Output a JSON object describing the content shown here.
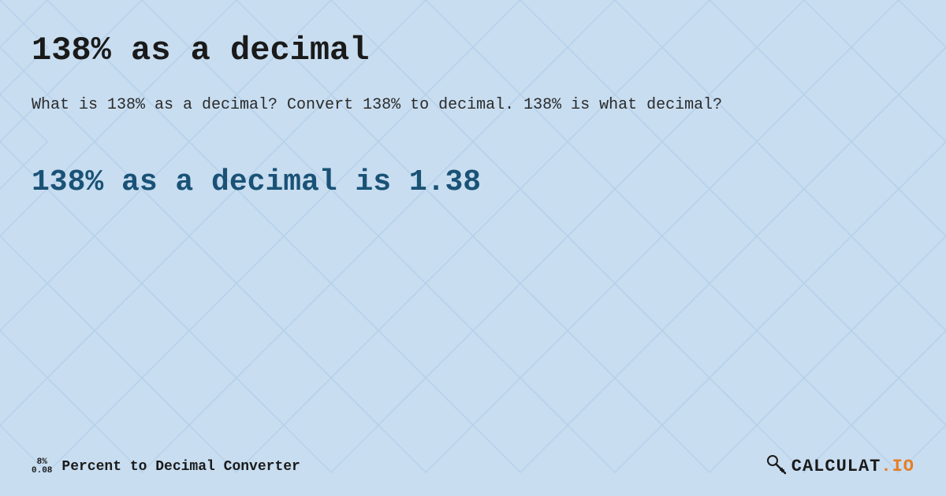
{
  "page": {
    "title": "138% as a decimal",
    "description": "What is 138% as a decimal? Convert 138% to decimal. 138% is what decimal?",
    "result": "138% as a decimal is 1.38",
    "background_color": "#c8ddf0"
  },
  "footer": {
    "icon_percent": "8%",
    "icon_decimal": "0.08",
    "label": "Percent to Decimal Converter",
    "logo_text": "CALCULAT.IO"
  }
}
